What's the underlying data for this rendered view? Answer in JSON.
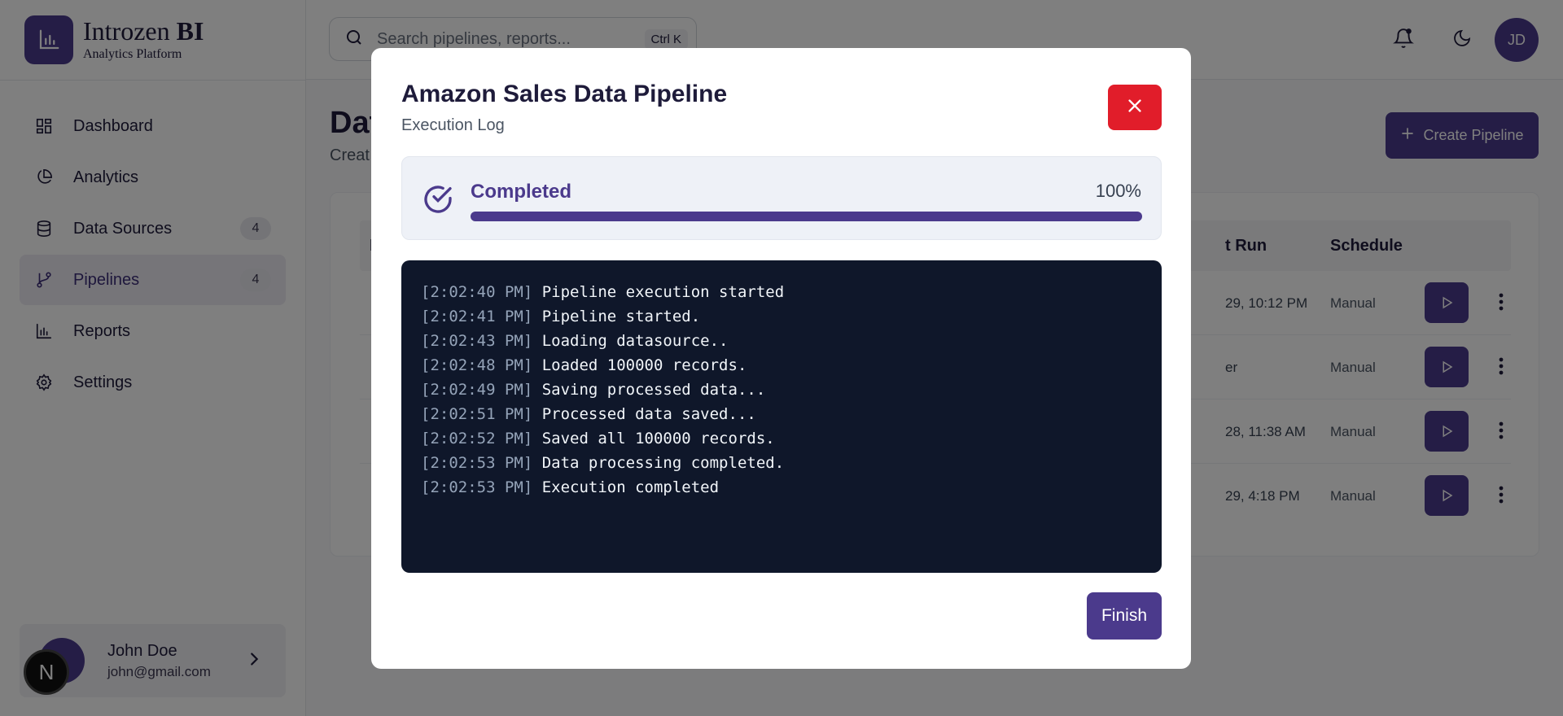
{
  "brand": {
    "name": "Introzen",
    "name_bold": "BI",
    "subtitle": "Analytics Platform"
  },
  "nav": {
    "items": [
      {
        "label": "Dashboard",
        "icon": "dashboard-icon"
      },
      {
        "label": "Analytics",
        "icon": "pie-chart-icon"
      },
      {
        "label": "Data Sources",
        "icon": "database-icon",
        "badge": "4"
      },
      {
        "label": "Pipelines",
        "icon": "git-branch-icon",
        "badge": "4",
        "active": true
      },
      {
        "label": "Reports",
        "icon": "bar-chart-icon"
      },
      {
        "label": "Settings",
        "icon": "gear-icon"
      }
    ]
  },
  "user": {
    "name": "John Doe",
    "email": "john@gmail.com",
    "badge": "N"
  },
  "header": {
    "search_placeholder": "Search pipelines, reports...",
    "shortcut": "Ctrl K",
    "avatar_initials": "JD"
  },
  "main": {
    "title": "Dat",
    "subtitle": "Creat",
    "create_button": "Create Pipeline",
    "table": {
      "headers": {
        "first": "N",
        "last_run": "t Run",
        "schedule": "Schedule"
      },
      "rows": [
        {
          "last_run": "29, 10:12 PM",
          "schedule": "Manual"
        },
        {
          "last_run": "er",
          "schedule": "Manual"
        },
        {
          "last_run": "28, 11:38 AM",
          "schedule": "Manual"
        },
        {
          "last_run": "29, 4:18 PM",
          "schedule": "Manual"
        }
      ]
    }
  },
  "modal": {
    "title": "Amazon Sales Data Pipeline",
    "subtitle": "Execution Log",
    "status": "Completed",
    "progress": {
      "percent": 100,
      "label": "100%"
    },
    "log": [
      {
        "time": "[2:02:40 PM]",
        "message": "Pipeline execution started"
      },
      {
        "time": "[2:02:41 PM]",
        "message": "Pipeline started."
      },
      {
        "time": "[2:02:43 PM]",
        "message": "Loading datasource.."
      },
      {
        "time": "[2:02:48 PM]",
        "message": "Loaded 100000 records."
      },
      {
        "time": "[2:02:49 PM]",
        "message": "Saving processed data..."
      },
      {
        "time": "[2:02:51 PM]",
        "message": "Processed data saved..."
      },
      {
        "time": "[2:02:52 PM]",
        "message": "Saved all 100000 records."
      },
      {
        "time": "[2:02:53 PM]",
        "message": "Data processing completed."
      },
      {
        "time": "[2:02:53 PM]",
        "message": "Execution completed"
      }
    ],
    "finish_button": "Finish"
  },
  "colors": {
    "brand": "#4b3a8c",
    "close": "#e11d2a",
    "log_bg": "#0f172a"
  }
}
